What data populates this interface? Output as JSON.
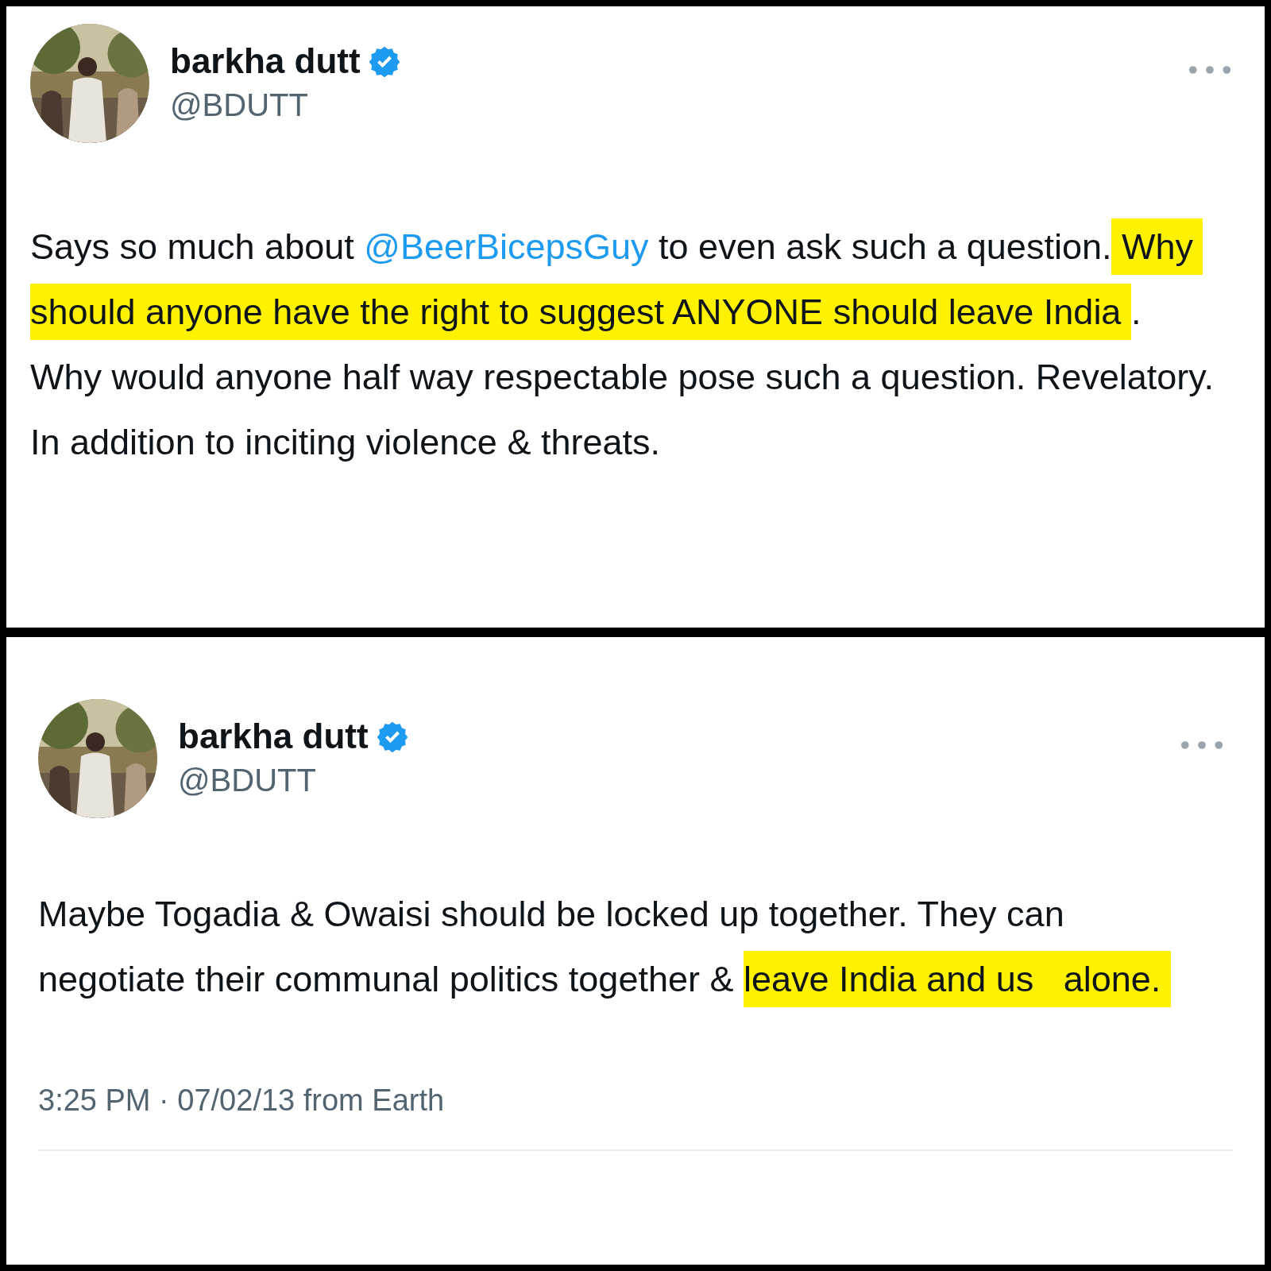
{
  "tweets": [
    {
      "author": {
        "name": "barkha dutt",
        "handle": "@BDUTT",
        "verified": true
      },
      "text": [
        {
          "kind": "text",
          "text": "Says so much about ",
          "highlight": false
        },
        {
          "kind": "mention",
          "text": "@BeerBicepsGuy",
          "highlight": false
        },
        {
          "kind": "text",
          "text": " to even ask such a question.",
          "highlight": false
        },
        {
          "kind": "text",
          "text": " Why should anyone have the right to suggest ANYONE should leave India ",
          "highlight": true
        },
        {
          "kind": "text",
          "text": ". Why would anyone half way respectable pose such a question. Revelatory.  In addition to inciting violence & threats.",
          "highlight": false
        }
      ]
    },
    {
      "author": {
        "name": "barkha dutt",
        "handle": "@BDUTT",
        "verified": true
      },
      "text": [
        {
          "kind": "text",
          "text": "Maybe Togadia & Owaisi should be locked up together. They can   negotiate their communal politics together & ",
          "highlight": false
        },
        {
          "kind": "text",
          "text": "leave India and us   alone. ",
          "highlight": true
        }
      ],
      "timestamp": "3:25 PM · 07/02/13 from Earth"
    }
  ]
}
